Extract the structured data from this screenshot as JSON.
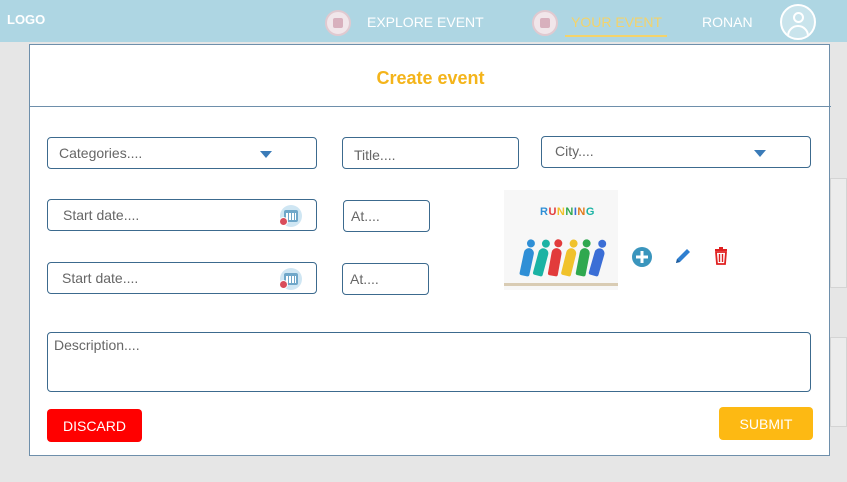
{
  "nav": {
    "logo": "LOGO",
    "explore_label": "EXPLORE EVENT",
    "your_event_label": "YOUR EVENT",
    "user_label": "RONAN"
  },
  "modal": {
    "title": "Create event",
    "categories_placeholder": "Categories....",
    "title_placeholder": "Title....",
    "city_placeholder": "City....",
    "start_date_1_placeholder": "Start date....",
    "at_1_placeholder": "At....",
    "start_date_2_placeholder": "Start date....",
    "at_2_placeholder": "At....",
    "description_placeholder": "Description....",
    "image_text": "RUNNING",
    "discard_label": "DISCARD",
    "submit_label": "SUBMIT"
  },
  "colors": {
    "accent": "#f4b41a",
    "discard": "#ff0000",
    "submit": "#fdb913",
    "topbar": "#aed6e3"
  },
  "icons": {
    "add": "plus-circle-icon",
    "edit": "pencil-icon",
    "delete": "trash-icon",
    "calendar": "calendar-icon"
  }
}
